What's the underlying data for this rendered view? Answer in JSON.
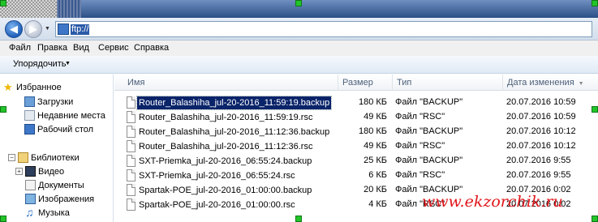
{
  "address": {
    "path": "ftp://"
  },
  "menu": [
    "Файл",
    "Правка",
    "Вид",
    "Сервис",
    "Справка"
  ],
  "commandbar": {
    "organize": "Упорядочить"
  },
  "navpane": {
    "favorites": "Избранное",
    "downloads": "Загрузки",
    "recent": "Недавние места",
    "desktop": "Рабочий стол",
    "libraries": "Библиотеки",
    "video": "Видео",
    "documents": "Документы",
    "images": "Изображения",
    "music": "Музыка"
  },
  "columns": {
    "name": "Имя",
    "size": "Размер",
    "type": "Тип",
    "date": "Дата изменения"
  },
  "files": [
    {
      "name": "Router_Balashiha_jul-20-2016_11:59:19.backup",
      "size": "180 КБ",
      "type": "Файл \"BACKUP\"",
      "date": "20.07.2016 10:59"
    },
    {
      "name": "Router_Balashiha_jul-20-2016_11:59:19.rsc",
      "size": "49 КБ",
      "type": "Файл \"RSC\"",
      "date": "20.07.2016 10:59"
    },
    {
      "name": "Router_Balashiha_jul-20-2016_11:12:36.backup",
      "size": "180 КБ",
      "type": "Файл \"BACKUP\"",
      "date": "20.07.2016 10:12"
    },
    {
      "name": "Router_Balashiha_jul-20-2016_11:12:36.rsc",
      "size": "49 КБ",
      "type": "Файл \"RSC\"",
      "date": "20.07.2016 10:12"
    },
    {
      "name": "SXT-Priemka_jul-20-2016_06:55:24.backup",
      "size": "25 КБ",
      "type": "Файл \"BACKUP\"",
      "date": "20.07.2016 9:55"
    },
    {
      "name": "SXT-Priemka_jul-20-2016_06:55:24.rsc",
      "size": "6 КБ",
      "type": "Файл \"RSC\"",
      "date": "20.07.2016 9:55"
    },
    {
      "name": "Spartak-POE_jul-20-2016_01:00:00.backup",
      "size": "20 КБ",
      "type": "Файл \"BACKUP\"",
      "date": "20.07.2016 0:02"
    },
    {
      "name": "Spartak-POE_jul-20-2016_01:00:00.rsc",
      "size": "4 КБ",
      "type": "Файл \"RSC\"",
      "date": "20.07.2016 0:02"
    }
  ],
  "watermark": "www.ekzorchik.ru",
  "colors": {
    "selection": "#0a246a",
    "watermark": "#e0151a",
    "handle": "#22c42a"
  }
}
